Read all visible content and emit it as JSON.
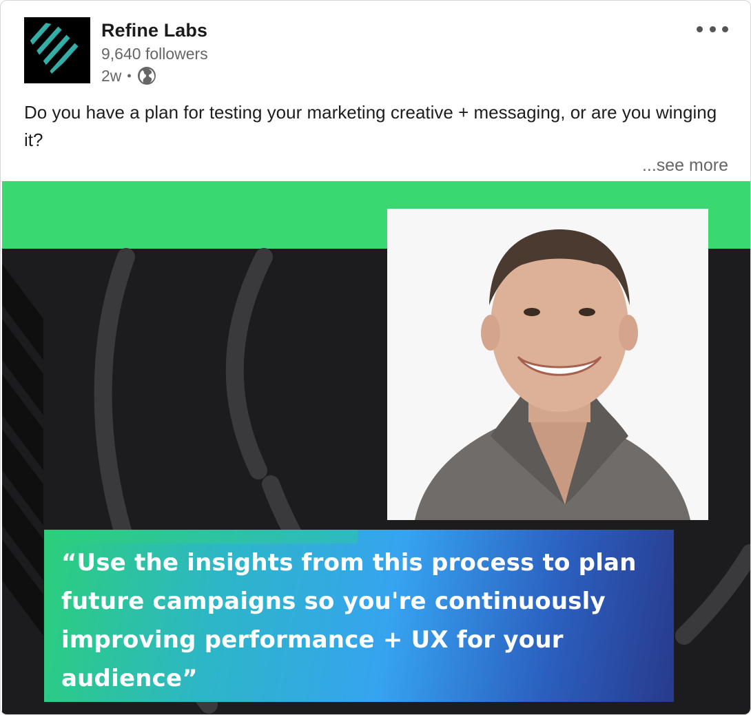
{
  "header": {
    "company_name": "Refine Labs",
    "followers": "9,640 followers",
    "time_ago": "2w",
    "separator": "•",
    "visibility_icon": "globe-icon",
    "more_icon": "ellipsis-icon"
  },
  "post": {
    "text": "Do you have a plan for testing your marketing creative + messaging, or are you winging it?",
    "see_more": "...see more"
  },
  "media": {
    "quote": "“Use the insights from this process to plan future campaigns so you're continuously improving performance + UX for your audience”",
    "band_color": "#39d870",
    "background_color": "#1c1c1e"
  },
  "colors": {
    "logo_gradient_start": "#2ee07a",
    "logo_gradient_end": "#3a7bd5",
    "quote_gradient_start": "#2ccf7a",
    "quote_gradient_end": "#283a8c"
  }
}
